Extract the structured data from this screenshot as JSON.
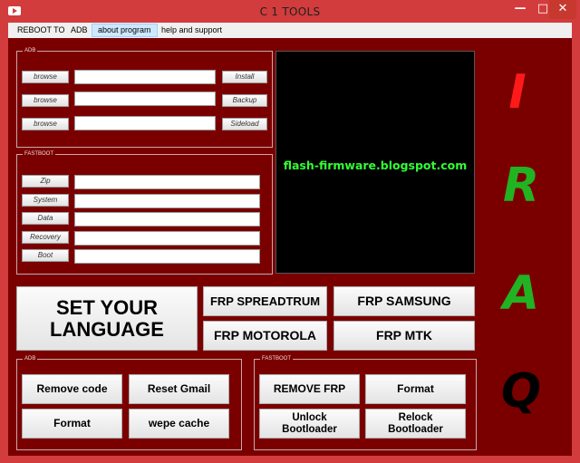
{
  "window": {
    "title": "C 1 TOOLS",
    "min_glyph": "—",
    "max_glyph": "□",
    "close_glyph": "✕"
  },
  "menu": {
    "items": [
      "REBOOT TO",
      "ADB",
      "about program",
      "help and support"
    ]
  },
  "adb_top": {
    "label": "ADB",
    "browse_label": "browse",
    "buttons": [
      "Install",
      "Backup",
      "Sideload"
    ]
  },
  "fastboot_top": {
    "label": "FASTBOOT",
    "buttons": [
      "Zip",
      "System",
      "Data",
      "Recovery",
      "Boot"
    ]
  },
  "console": {
    "text": "flash-firmware.blogspot.com"
  },
  "language_button": "SET YOUR LANGUAGE",
  "frp": {
    "spreadtrum": "FRP SPREADTRUM",
    "samsung": "FRP SAMSUNG",
    "motorola": "FRP MOTOROLA",
    "mtk": "FRP MTK"
  },
  "adb_bottom": {
    "label": "ADB",
    "remove_code": "Remove code",
    "reset_gmail": "Reset Gmail",
    "format": "Format",
    "wipe_cache": "wepe cache"
  },
  "fastboot_bottom": {
    "label": "FASTBOOT",
    "remove_frp": "REMOVE FRP",
    "format": "Format",
    "unlock": "Unlock Bootloader",
    "relock": "Relock Bootloader"
  },
  "brand_letters": [
    "I",
    "R",
    "A",
    "Q"
  ],
  "colors": {
    "titlebar": "#d23c3c",
    "client": "#7a0000",
    "console_text": "#33ff33",
    "letter_i": "#ff1a1a",
    "letter_r": "#22b322",
    "letter_a": "#22b322",
    "letter_q": "#000000"
  }
}
